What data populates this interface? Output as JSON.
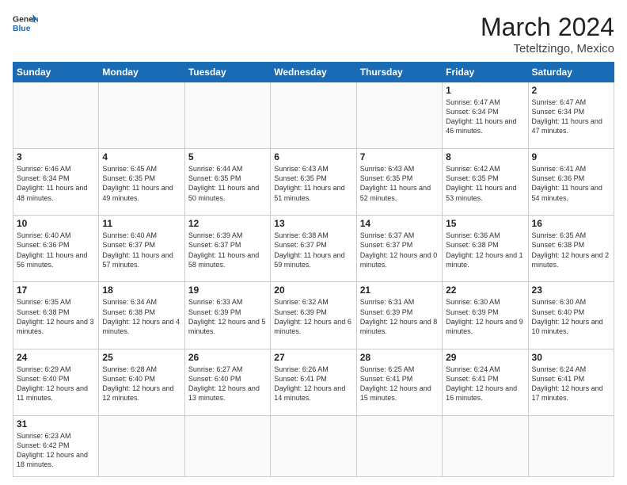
{
  "header": {
    "logo_general": "General",
    "logo_blue": "Blue",
    "month_year": "March 2024",
    "location": "Teteltzingo, Mexico"
  },
  "weekdays": [
    "Sunday",
    "Monday",
    "Tuesday",
    "Wednesday",
    "Thursday",
    "Friday",
    "Saturday"
  ],
  "weeks": [
    [
      {
        "day": "",
        "info": ""
      },
      {
        "day": "",
        "info": ""
      },
      {
        "day": "",
        "info": ""
      },
      {
        "day": "",
        "info": ""
      },
      {
        "day": "",
        "info": ""
      },
      {
        "day": "1",
        "info": "Sunrise: 6:47 AM\nSunset: 6:34 PM\nDaylight: 11 hours and 46 minutes."
      },
      {
        "day": "2",
        "info": "Sunrise: 6:47 AM\nSunset: 6:34 PM\nDaylight: 11 hours and 47 minutes."
      }
    ],
    [
      {
        "day": "3",
        "info": "Sunrise: 6:46 AM\nSunset: 6:34 PM\nDaylight: 11 hours and 48 minutes."
      },
      {
        "day": "4",
        "info": "Sunrise: 6:45 AM\nSunset: 6:35 PM\nDaylight: 11 hours and 49 minutes."
      },
      {
        "day": "5",
        "info": "Sunrise: 6:44 AM\nSunset: 6:35 PM\nDaylight: 11 hours and 50 minutes."
      },
      {
        "day": "6",
        "info": "Sunrise: 6:43 AM\nSunset: 6:35 PM\nDaylight: 11 hours and 51 minutes."
      },
      {
        "day": "7",
        "info": "Sunrise: 6:43 AM\nSunset: 6:35 PM\nDaylight: 11 hours and 52 minutes."
      },
      {
        "day": "8",
        "info": "Sunrise: 6:42 AM\nSunset: 6:35 PM\nDaylight: 11 hours and 53 minutes."
      },
      {
        "day": "9",
        "info": "Sunrise: 6:41 AM\nSunset: 6:36 PM\nDaylight: 11 hours and 54 minutes."
      }
    ],
    [
      {
        "day": "10",
        "info": "Sunrise: 6:40 AM\nSunset: 6:36 PM\nDaylight: 11 hours and 56 minutes."
      },
      {
        "day": "11",
        "info": "Sunrise: 6:40 AM\nSunset: 6:37 PM\nDaylight: 11 hours and 57 minutes."
      },
      {
        "day": "12",
        "info": "Sunrise: 6:39 AM\nSunset: 6:37 PM\nDaylight: 11 hours and 58 minutes."
      },
      {
        "day": "13",
        "info": "Sunrise: 6:38 AM\nSunset: 6:37 PM\nDaylight: 11 hours and 59 minutes."
      },
      {
        "day": "14",
        "info": "Sunrise: 6:37 AM\nSunset: 6:37 PM\nDaylight: 12 hours and 0 minutes."
      },
      {
        "day": "15",
        "info": "Sunrise: 6:36 AM\nSunset: 6:38 PM\nDaylight: 12 hours and 1 minute."
      },
      {
        "day": "16",
        "info": "Sunrise: 6:35 AM\nSunset: 6:38 PM\nDaylight: 12 hours and 2 minutes."
      }
    ],
    [
      {
        "day": "17",
        "info": "Sunrise: 6:35 AM\nSunset: 6:38 PM\nDaylight: 12 hours and 3 minutes."
      },
      {
        "day": "18",
        "info": "Sunrise: 6:34 AM\nSunset: 6:38 PM\nDaylight: 12 hours and 4 minutes."
      },
      {
        "day": "19",
        "info": "Sunrise: 6:33 AM\nSunset: 6:39 PM\nDaylight: 12 hours and 5 minutes."
      },
      {
        "day": "20",
        "info": "Sunrise: 6:32 AM\nSunset: 6:39 PM\nDaylight: 12 hours and 6 minutes."
      },
      {
        "day": "21",
        "info": "Sunrise: 6:31 AM\nSunset: 6:39 PM\nDaylight: 12 hours and 8 minutes."
      },
      {
        "day": "22",
        "info": "Sunrise: 6:30 AM\nSunset: 6:39 PM\nDaylight: 12 hours and 9 minutes."
      },
      {
        "day": "23",
        "info": "Sunrise: 6:30 AM\nSunset: 6:40 PM\nDaylight: 12 hours and 10 minutes."
      }
    ],
    [
      {
        "day": "24",
        "info": "Sunrise: 6:29 AM\nSunset: 6:40 PM\nDaylight: 12 hours and 11 minutes."
      },
      {
        "day": "25",
        "info": "Sunrise: 6:28 AM\nSunset: 6:40 PM\nDaylight: 12 hours and 12 minutes."
      },
      {
        "day": "26",
        "info": "Sunrise: 6:27 AM\nSunset: 6:40 PM\nDaylight: 12 hours and 13 minutes."
      },
      {
        "day": "27",
        "info": "Sunrise: 6:26 AM\nSunset: 6:41 PM\nDaylight: 12 hours and 14 minutes."
      },
      {
        "day": "28",
        "info": "Sunrise: 6:25 AM\nSunset: 6:41 PM\nDaylight: 12 hours and 15 minutes."
      },
      {
        "day": "29",
        "info": "Sunrise: 6:24 AM\nSunset: 6:41 PM\nDaylight: 12 hours and 16 minutes."
      },
      {
        "day": "30",
        "info": "Sunrise: 6:24 AM\nSunset: 6:41 PM\nDaylight: 12 hours and 17 minutes."
      }
    ],
    [
      {
        "day": "31",
        "info": "Sunrise: 6:23 AM\nSunset: 6:42 PM\nDaylight: 12 hours and 18 minutes."
      },
      {
        "day": "",
        "info": ""
      },
      {
        "day": "",
        "info": ""
      },
      {
        "day": "",
        "info": ""
      },
      {
        "day": "",
        "info": ""
      },
      {
        "day": "",
        "info": ""
      },
      {
        "day": "",
        "info": ""
      }
    ]
  ]
}
